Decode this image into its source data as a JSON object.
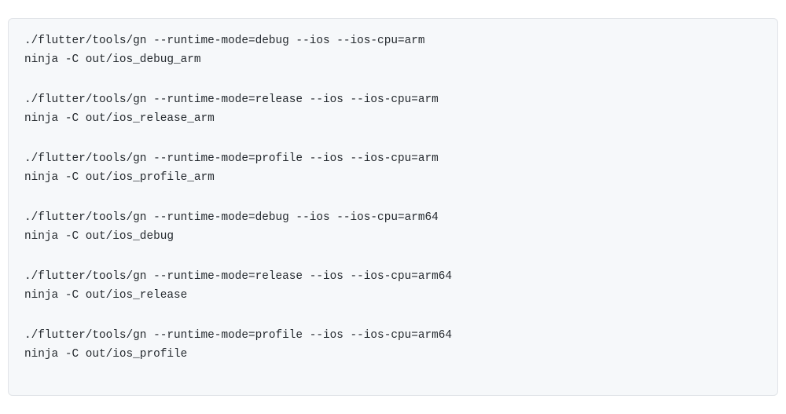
{
  "groups": [
    {
      "line1": "./flutter/tools/gn --runtime-mode=debug --ios --ios-cpu=arm",
      "line2": "ninja -C out/ios_debug_arm"
    },
    {
      "line1": "./flutter/tools/gn --runtime-mode=release --ios --ios-cpu=arm",
      "line2": "ninja -C out/ios_release_arm"
    },
    {
      "line1": "./flutter/tools/gn --runtime-mode=profile --ios --ios-cpu=arm",
      "line2": "ninja -C out/ios_profile_arm"
    },
    {
      "line1": "./flutter/tools/gn --runtime-mode=debug --ios --ios-cpu=arm64",
      "line2": "ninja -C out/ios_debug"
    },
    {
      "line1": "./flutter/tools/gn --runtime-mode=release --ios --ios-cpu=arm64",
      "line2": "ninja -C out/ios_release"
    },
    {
      "line1": "./flutter/tools/gn --runtime-mode=profile --ios --ios-cpu=arm64",
      "line2": "ninja -C out/ios_profile"
    }
  ]
}
